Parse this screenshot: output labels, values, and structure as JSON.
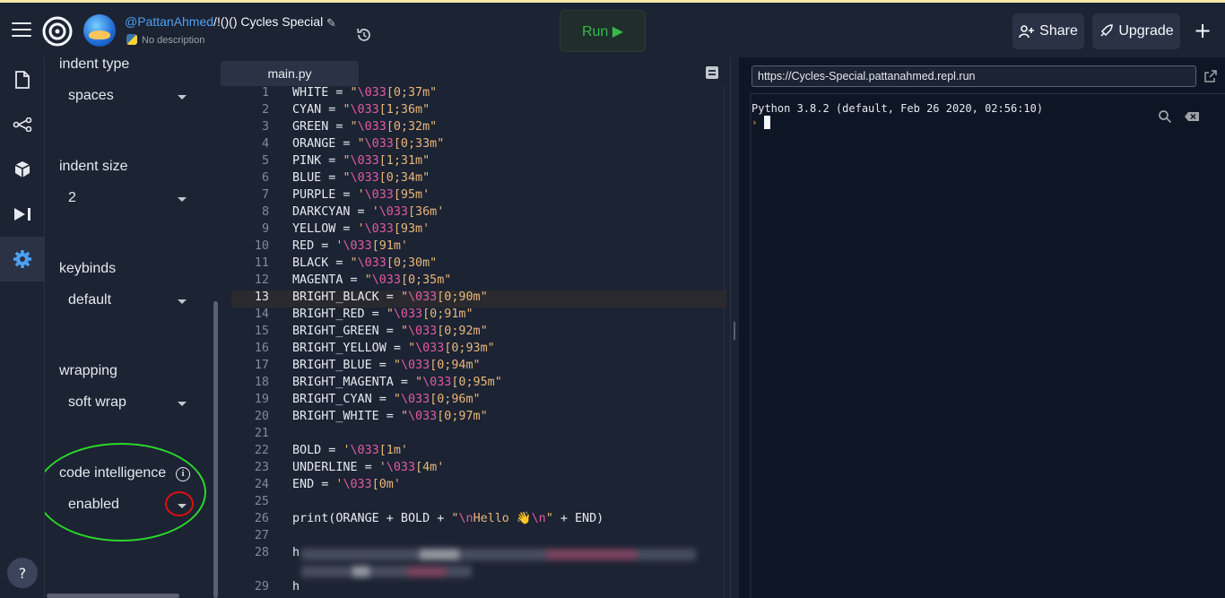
{
  "header": {
    "username": "@PattanAhmed",
    "separator": "/",
    "repl_name": "!()() Cycles Special",
    "description": "No description",
    "run_label": "Run ▶",
    "share_label": "Share",
    "upgrade_label": "Upgrade"
  },
  "sidebar_icons": [
    "files-icon",
    "version-control-icon",
    "packages-icon",
    "debugger-icon",
    "settings-icon"
  ],
  "settings": {
    "indent_type_label": "indent type",
    "indent_type_value": "spaces",
    "indent_size_label": "indent size",
    "indent_size_value": "2",
    "keybinds_label": "keybinds",
    "keybinds_value": "default",
    "wrapping_label": "wrapping",
    "wrapping_value": "soft wrap",
    "code_intelligence_label": "code intelligence",
    "code_intelligence_value": "enabled"
  },
  "help_label": "?",
  "editor": {
    "tab_label": "main.py",
    "active_line": 13,
    "lines": [
      {
        "n": "1",
        "t": "WHITE = \"\\033[0;37m\""
      },
      {
        "n": "2",
        "t": "CYAN = \"\\033[1;36m\""
      },
      {
        "n": "3",
        "t": "GREEN = \"\\033[0;32m\""
      },
      {
        "n": "4",
        "t": "ORANGE = \"\\033[0;33m\""
      },
      {
        "n": "5",
        "t": "PINK = \"\\033[1;31m\""
      },
      {
        "n": "6",
        "t": "BLUE = \"\\033[0;34m\""
      },
      {
        "n": "7",
        "t": "PURPLE = '\\033[95m'"
      },
      {
        "n": "8",
        "t": "DARKCYAN = '\\033[36m'"
      },
      {
        "n": "9",
        "t": "YELLOW = '\\033[93m'"
      },
      {
        "n": "10",
        "t": "RED = '\\033[91m'"
      },
      {
        "n": "11",
        "t": "BLACK = \"\\033[0;30m\""
      },
      {
        "n": "12",
        "t": "MAGENTA = \"\\033[0;35m\""
      },
      {
        "n": "13",
        "t": "BRIGHT_BLACK = \"\\033[0;90m\""
      },
      {
        "n": "14",
        "t": "BRIGHT_RED = \"\\033[0;91m\""
      },
      {
        "n": "15",
        "t": "BRIGHT_GREEN = \"\\033[0;92m\""
      },
      {
        "n": "16",
        "t": "BRIGHT_YELLOW = \"\\033[0;93m\""
      },
      {
        "n": "17",
        "t": "BRIGHT_BLUE = \"\\033[0;94m\""
      },
      {
        "n": "18",
        "t": "BRIGHT_MAGENTA = \"\\033[0;95m\""
      },
      {
        "n": "19",
        "t": "BRIGHT_CYAN = \"\\033[0;96m\""
      },
      {
        "n": "20",
        "t": "BRIGHT_WHITE = \"\\033[0;97m\""
      },
      {
        "n": "21",
        "t": ""
      },
      {
        "n": "22",
        "t": "BOLD = '\\033[1m'"
      },
      {
        "n": "23",
        "t": "UNDERLINE = '\\033[4m'"
      },
      {
        "n": "24",
        "t": "END = '\\033[0m'"
      },
      {
        "n": "25",
        "t": ""
      },
      {
        "n": "26",
        "t": "print(ORANGE + BOLD + \"\\nHello 👋\\n\" + END)"
      },
      {
        "n": "27",
        "t": ""
      },
      {
        "n": "28",
        "t": "h"
      },
      {
        "n": "",
        "t": ""
      },
      {
        "n": "29",
        "t": "h"
      }
    ]
  },
  "webview": {
    "url": "https://Cycles-Special.pattanahmed.repl.run"
  },
  "console": {
    "banner": "Python 3.8.2 (default, Feb 26 2020, 02:56:10)",
    "prompt": "›"
  },
  "colors": {
    "bg": "#0e1525",
    "panel": "#1c2333",
    "run_green": "#36b94a",
    "link_blue": "#4ea1f3",
    "string": "#e8b77a",
    "escape": "#e05ba2",
    "annotation_green": "#2bd62b",
    "annotation_red": "#e01010"
  }
}
